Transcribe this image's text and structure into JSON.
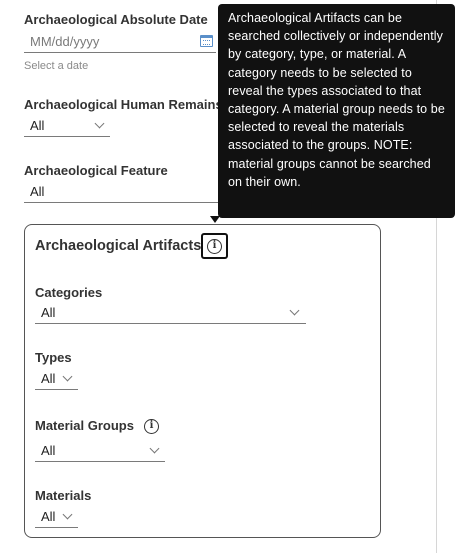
{
  "absolute_date": {
    "label": "Archaeological Absolute Date",
    "placeholder": "MM/dd/yyyy",
    "helper": "Select a date",
    "icon": "calendar-icon"
  },
  "human_remains": {
    "label": "Archaeological Human Remains",
    "value": "All"
  },
  "feature": {
    "label": "Archaeological Feature",
    "value": "All"
  },
  "artifacts": {
    "title": "Archaeological Artifacts",
    "info_icon": "info-icon",
    "categories": {
      "label": "Categories",
      "value": "All"
    },
    "types": {
      "label": "Types",
      "value": "All"
    },
    "material_groups": {
      "label": "Material Groups",
      "value": "All",
      "info_icon": "info-icon"
    },
    "materials": {
      "label": "Materials",
      "value": "All"
    }
  },
  "tooltip": {
    "text": "Archaeological Artifacts can be searched collectively or independently by category, type, or material. A category needs to be selected to reveal the types associated to that category. A material group needs to be selected to reveal the materials associated to the groups. NOTE: material groups cannot be searched on their own."
  }
}
